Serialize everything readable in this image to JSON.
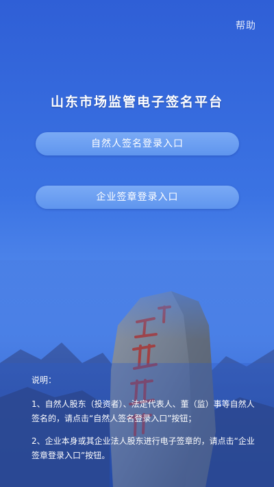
{
  "header": {
    "help_label": "帮助"
  },
  "main": {
    "title": "山东市场监管电子签名平台",
    "person_login_label": "自然人签名登录入口",
    "company_login_label": "企业签章登录入口"
  },
  "scenery": {
    "stele_inscription": "五岳独尊"
  },
  "notes": {
    "heading": "说明：",
    "items": [
      "1、自然人股东（投资者）、法定代表人、董（监）事等自然人签名的，请点击“自然人签名登录入口”按钮；",
      "2、企业本身或其企业法人股东进行电子签章的，请点击“企业签章登录入口”按钮。"
    ]
  },
  "colors": {
    "background_top": "#2f5fd6",
    "background_mid": "#4d84ea",
    "button_fill": "#6a9ff2",
    "text": "#ffffff"
  }
}
